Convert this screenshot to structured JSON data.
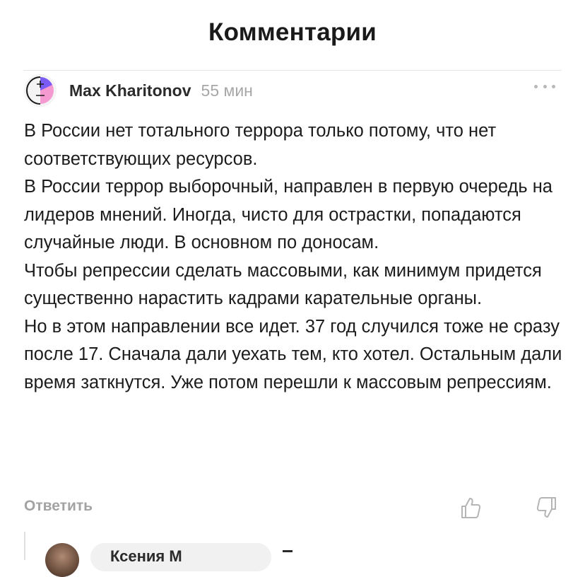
{
  "header": {
    "title": "Комментарии"
  },
  "comment": {
    "author": "Max Kharitonov",
    "time": "55 мин",
    "paragraphs": [
      "В России нет тотального террора только потому, что нет соответствующих ресурсов.",
      "В России террор выборочный, направлен в первую очередь на лидеров мнений. Иногда, чисто для острастки, попадаются случайные люди. В основном по доносам.",
      "Чтобы репрессии сделать массовыми, как минимум придется существенно нарастить кадрами карательные органы.",
      "Но в этом направлении все идет. 37 год случился тоже не сразу после 17. Сначала дали уехать тем, кто хотел. Остальным дали время заткнутся. Уже потом перешли к массовым репрессиям."
    ],
    "reply_label": "Ответить"
  },
  "next_reply": {
    "author": "Ксения М"
  },
  "icons": {
    "more": "more-dots-icon",
    "like": "thumbs-up-icon",
    "dislike": "thumbs-down-icon"
  },
  "colors": {
    "avatar_purple": "#7a5cf5",
    "avatar_pink": "#f59ad0",
    "muted": "#a3a3a3"
  }
}
